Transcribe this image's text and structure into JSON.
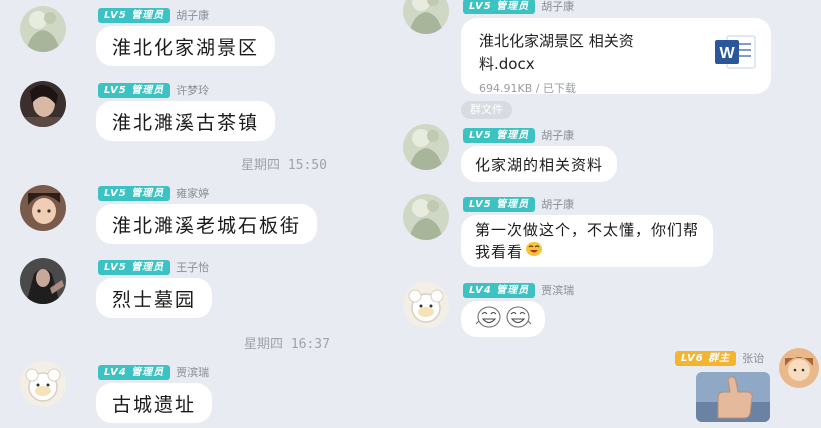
{
  "left": {
    "messages": [
      {
        "level": "LV5",
        "role": "管理员",
        "sender": "胡子康",
        "text": "淮北化家湖景区"
      },
      {
        "level": "LV5",
        "role": "管理员",
        "sender": "许梦玲",
        "text": "淮北濉溪古茶镇"
      },
      {
        "level": "LV5",
        "role": "管理员",
        "sender": "雍家婷",
        "text": "淮北濉溪老城石板街"
      },
      {
        "level": "LV5",
        "role": "管理员",
        "sender": "王子怡",
        "text": "烈士墓园"
      },
      {
        "level": "LV4",
        "role": "管理员",
        "sender": "贾滨瑞",
        "text": "古城遗址"
      }
    ],
    "timestamps": [
      "星期四 15:50",
      "星期四 16:37"
    ]
  },
  "right": {
    "file_message": {
      "level": "LV5",
      "role": "管理员",
      "sender": "胡子康",
      "file_name": "淮北化家湖景区 相关资料.docx",
      "file_size": "694.91KB",
      "file_status": "已下载",
      "file_size_line": "694.91KB / 已下载",
      "file_icon": "word-doc-icon",
      "file_icon_letter": "W"
    },
    "group_file_label": "群文件",
    "messages": [
      {
        "level": "LV5",
        "role": "管理员",
        "sender": "胡子康",
        "text": "化家湖的相关资料"
      },
      {
        "level": "LV5",
        "role": "管理员",
        "sender": "胡子康",
        "text_line1": "第一次做这个，不太懂，你们帮",
        "text_line2": "我看看"
      },
      {
        "level": "LV4",
        "role": "管理员",
        "sender": "贾滨瑞",
        "sticker": "laughing-face-emojis"
      },
      {
        "level": "LV6",
        "role": "群主",
        "sender": "张诒",
        "image": "thumbs-up-photo"
      }
    ]
  },
  "colors": {
    "background": "#e9ebf3",
    "admin_badge": "#3cc2c2",
    "owner_badge": "#f2b431",
    "bubble": "#ffffff",
    "word_blue": "#2b579a"
  }
}
